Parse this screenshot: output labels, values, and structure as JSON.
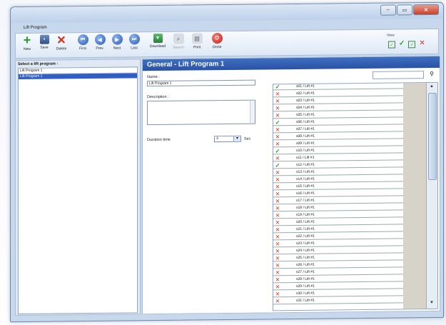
{
  "window": {
    "title": "Lift Program"
  },
  "toolbar": {
    "buttons": [
      {
        "label": "New",
        "icon": "plus-icon"
      },
      {
        "label": "Save",
        "icon": "floppy-icon"
      },
      {
        "label": "Delete",
        "icon": "x-icon"
      },
      {
        "label": "First",
        "icon": "first-icon"
      },
      {
        "label": "Prev.",
        "icon": "prev-icon"
      },
      {
        "label": "Next",
        "icon": "next-icon"
      },
      {
        "label": "Last",
        "icon": "last-icon"
      },
      {
        "label": "Download",
        "icon": "download-icon"
      },
      {
        "label": "Search",
        "icon": "search-icon"
      },
      {
        "label": "Print",
        "icon": "printer-icon"
      },
      {
        "label": "Close",
        "icon": "close-icon"
      }
    ],
    "view_label": "View"
  },
  "left": {
    "title": "Select a lift program :",
    "header": "Lift Program 1",
    "items": [
      "Lift Program 1"
    ]
  },
  "general": {
    "heading": "General - Lift Program 1",
    "name_label": "Name :",
    "name_value": "Lift Program 1",
    "description_label": "Description :",
    "duration_label": "Duration time",
    "duration_value": "3",
    "duration_unit": "Sec"
  },
  "lifts": [
    {
      "label": "s01 / Lift #1",
      "on": true
    },
    {
      "label": "s02 / Lift #1",
      "on": false
    },
    {
      "label": "s03 / Lift #1",
      "on": false
    },
    {
      "label": "s04 / Lift #1",
      "on": false
    },
    {
      "label": "s05 / Lift #1",
      "on": false
    },
    {
      "label": "s06 / Lift #1",
      "on": true
    },
    {
      "label": "s07 / Lift #1",
      "on": false
    },
    {
      "label": "s08 / Lift #1",
      "on": false
    },
    {
      "label": "s09 / Lift #1",
      "on": false
    },
    {
      "label": "s10 / Lift #1",
      "on": true
    },
    {
      "label": "s11 / Lift #1",
      "on": false
    },
    {
      "label": "s12 / Lift #1",
      "on": true
    },
    {
      "label": "s13 / Lift #1",
      "on": false
    },
    {
      "label": "s14 / Lift #1",
      "on": false
    },
    {
      "label": "s15 / Lift #1",
      "on": false
    },
    {
      "label": "s16 / Lift #1",
      "on": false
    },
    {
      "label": "s17 / Lift #1",
      "on": false
    },
    {
      "label": "s18 / Lift #1",
      "on": false
    },
    {
      "label": "s19 / Lift #1",
      "on": false
    },
    {
      "label": "s20 / Lift #1",
      "on": false
    },
    {
      "label": "s21 / Lift #1",
      "on": false
    },
    {
      "label": "s22 / Lift #1",
      "on": false
    },
    {
      "label": "s23 / Lift #1",
      "on": false
    },
    {
      "label": "s24 / Lift #1",
      "on": false
    },
    {
      "label": "s25 / Lift #1",
      "on": false
    },
    {
      "label": "s26 / Lift #1",
      "on": false
    },
    {
      "label": "s27 / Lift #1",
      "on": false
    },
    {
      "label": "s28 / Lift #1",
      "on": false
    },
    {
      "label": "s29 / Lift #1",
      "on": false
    },
    {
      "label": "s30 / Lift #1",
      "on": false
    },
    {
      "label": "s31 / Lift #1",
      "on": false
    }
  ]
}
